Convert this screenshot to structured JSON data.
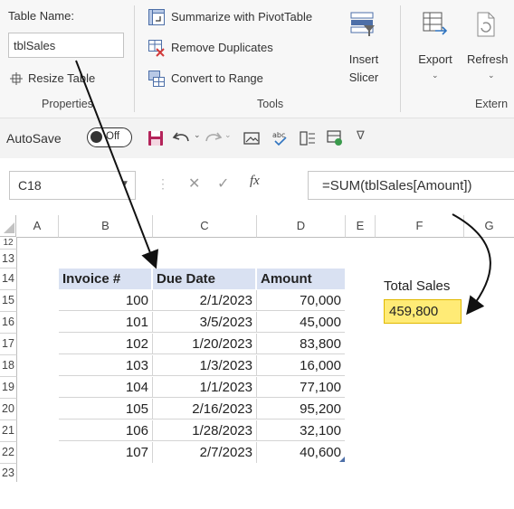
{
  "ribbon": {
    "table_name_label": "Table Name:",
    "table_name_value": "tblSales",
    "resize_table": "Resize Table",
    "properties_group": "Properties",
    "summarize_pivot": "Summarize with PivotTable",
    "remove_duplicates": "Remove Duplicates",
    "convert_to_range": "Convert to Range",
    "tools_group": "Tools",
    "insert_slicer_line1": "Insert",
    "insert_slicer_line2": "Slicer",
    "export": "Export",
    "refresh": "Refresh",
    "external_group": "Extern"
  },
  "qat": {
    "autosave_label": "AutoSave",
    "toggle_state": "Off"
  },
  "formula_bar": {
    "name_box": "C18",
    "fx": "fx",
    "formula": "=SUM(tblSales[Amount])"
  },
  "sheet": {
    "columns": [
      "A",
      "B",
      "C",
      "D",
      "E",
      "F",
      "G"
    ],
    "rows": [
      "12",
      "13",
      "14",
      "15",
      "16",
      "17",
      "18",
      "19",
      "20",
      "21",
      "22",
      "23"
    ],
    "table_headers": [
      "Invoice #",
      "Due Date",
      "Amount"
    ],
    "table_rows": [
      [
        "100",
        "2/1/2023",
        "70,000"
      ],
      [
        "101",
        "3/5/2023",
        "45,000"
      ],
      [
        "102",
        "1/20/2023",
        "83,800"
      ],
      [
        "103",
        "1/3/2023",
        "16,000"
      ],
      [
        "104",
        "1/1/2023",
        "77,100"
      ],
      [
        "105",
        "2/16/2023",
        "95,200"
      ],
      [
        "106",
        "1/28/2023",
        "32,100"
      ],
      [
        "107",
        "2/7/2023",
        "40,600"
      ]
    ],
    "total_label": "Total Sales",
    "total_value": "459,800"
  },
  "colors": {
    "table_header_fill": "#d9e1f2",
    "highlight_fill": "#ffeb76",
    "highlight_border": "#e0b800",
    "save_icon": "#b4245a",
    "toggle_dark": "#333333"
  }
}
